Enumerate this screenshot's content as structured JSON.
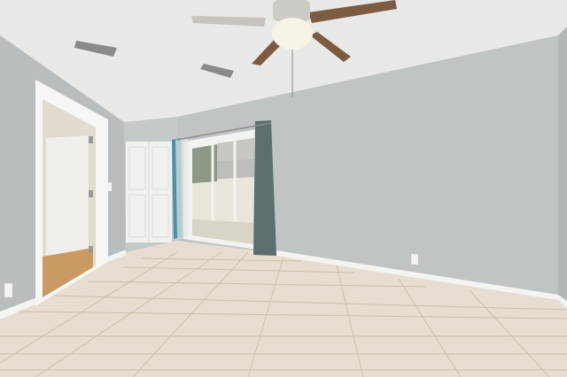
{
  "scene": {
    "description_visible_text": "",
    "colors": {
      "wall": "#bfc3c4",
      "wall_dark": "#aeb2b3",
      "ceiling": "#e9e9e7",
      "floor": "#e8dfd2",
      "grout": "#cfc3b2",
      "baseboard": "#f4f4f2",
      "door": "#efefed",
      "curtain": "#5e6f70",
      "fan_blade": "#7a5a40",
      "wood_floor": "#c99a63",
      "fence": "#e9e4da",
      "outdoor": "#bcbcb8"
    }
  }
}
